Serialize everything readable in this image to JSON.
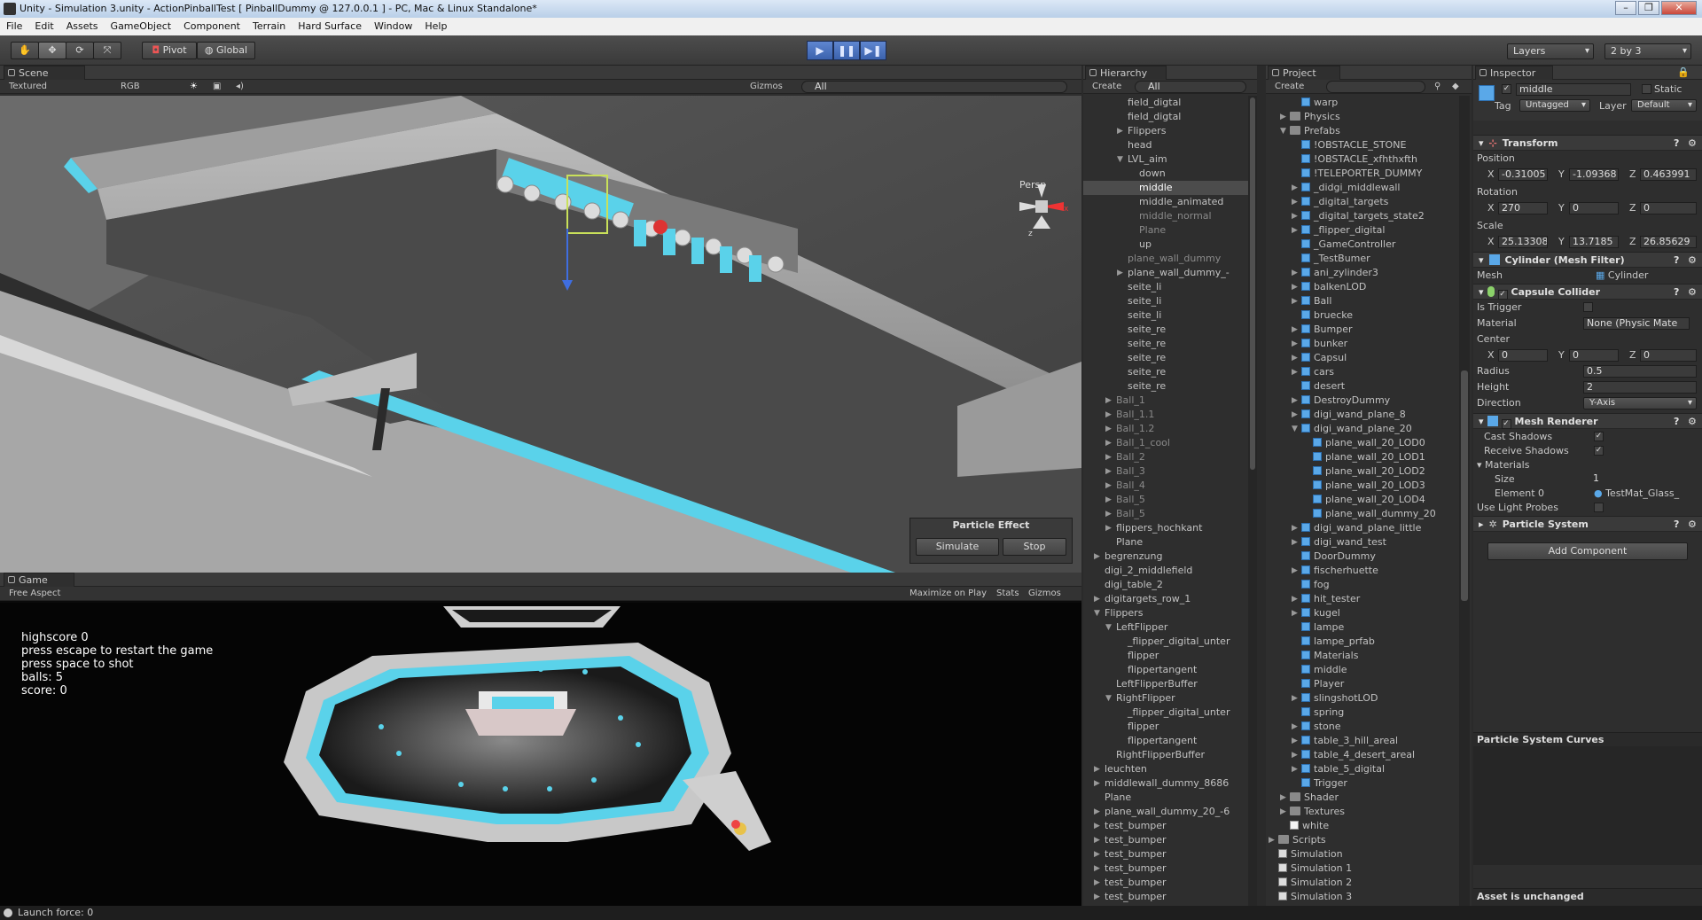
{
  "window": {
    "title": "Unity - Simulation 3.unity - ActionPinballTest [ PinballDummy @ 127.0.0.1 ] - PC, Mac & Linux Standalone*"
  },
  "menu": [
    "File",
    "Edit",
    "Assets",
    "GameObject",
    "Component",
    "Terrain",
    "Hard Surface",
    "Window",
    "Help"
  ],
  "toolbar": {
    "pivot": "Pivot",
    "global": "Global",
    "layers": "Layers",
    "layout": "2 by 3"
  },
  "scene": {
    "tab": "Scene",
    "shading": "Textured",
    "render_mode": "RGB",
    "gizmos": "Gizmos",
    "search": "All",
    "persp": "Persp",
    "particle_title": "Particle Effect",
    "simulate": "Simulate",
    "stop": "Stop"
  },
  "game": {
    "tab": "Game",
    "aspect": "Free Aspect",
    "maximize": "Maximize on Play",
    "stats": "Stats",
    "gizmos": "Gizmos",
    "lines": [
      "highscore 0",
      "press escape to restart the game",
      "press space to shot",
      "balls: 5",
      "score: 0"
    ]
  },
  "hierarchy": {
    "tab": "Hierarchy",
    "create": "Create",
    "search": "All",
    "items": [
      {
        "t": "field_digtal",
        "d": 2
      },
      {
        "t": "field_digtal",
        "d": 2
      },
      {
        "t": "Flippers",
        "d": 2,
        "a": "r"
      },
      {
        "t": "head",
        "d": 2
      },
      {
        "t": "LVL_aim",
        "d": 2,
        "a": "d"
      },
      {
        "t": "down",
        "d": 3
      },
      {
        "t": "middle",
        "d": 3,
        "sel": true
      },
      {
        "t": "middle_animated",
        "d": 3
      },
      {
        "t": "middle_normal",
        "d": 3,
        "dim": true
      },
      {
        "t": "Plane",
        "d": 3,
        "dim": true
      },
      {
        "t": "up",
        "d": 3
      },
      {
        "t": "plane_wall_dummy",
        "d": 2,
        "dim": true
      },
      {
        "t": "plane_wall_dummy_-",
        "d": 2,
        "a": "r"
      },
      {
        "t": "seite_li",
        "d": 2
      },
      {
        "t": "seite_li",
        "d": 2
      },
      {
        "t": "seite_li",
        "d": 2
      },
      {
        "t": "seite_re",
        "d": 2
      },
      {
        "t": "seite_re",
        "d": 2
      },
      {
        "t": "seite_re",
        "d": 2
      },
      {
        "t": "seite_re",
        "d": 2
      },
      {
        "t": "seite_re",
        "d": 2
      },
      {
        "t": "Ball_1",
        "d": 1,
        "a": "r",
        "dim": true
      },
      {
        "t": "Ball_1.1",
        "d": 1,
        "a": "r",
        "dim": true
      },
      {
        "t": "Ball_1.2",
        "d": 1,
        "a": "r",
        "dim": true
      },
      {
        "t": "Ball_1_cool",
        "d": 1,
        "a": "r",
        "dim": true
      },
      {
        "t": "Ball_2",
        "d": 1,
        "a": "r",
        "dim": true
      },
      {
        "t": "Ball_3",
        "d": 1,
        "a": "r",
        "dim": true
      },
      {
        "t": "Ball_4",
        "d": 1,
        "a": "r",
        "dim": true
      },
      {
        "t": "Ball_5",
        "d": 1,
        "a": "r",
        "dim": true
      },
      {
        "t": "Ball_5",
        "d": 1,
        "a": "r",
        "dim": true
      },
      {
        "t": "flippers_hochkant",
        "d": 1,
        "a": "r"
      },
      {
        "t": "Plane",
        "d": 1
      },
      {
        "t": "begrenzung",
        "d": 0,
        "a": "r"
      },
      {
        "t": "digi_2_middlefield",
        "d": 0
      },
      {
        "t": "digi_table_2",
        "d": 0
      },
      {
        "t": "digitargets_row_1",
        "d": 0,
        "a": "r"
      },
      {
        "t": "Flippers",
        "d": 0,
        "a": "d"
      },
      {
        "t": "LeftFlipper",
        "d": 1,
        "a": "d"
      },
      {
        "t": "_flipper_digital_unter",
        "d": 2
      },
      {
        "t": "flipper",
        "d": 2
      },
      {
        "t": "flippertangent",
        "d": 2
      },
      {
        "t": "LeftFlipperBuffer",
        "d": 1
      },
      {
        "t": "RightFlipper",
        "d": 1,
        "a": "d"
      },
      {
        "t": "_flipper_digital_unter",
        "d": 2
      },
      {
        "t": "flipper",
        "d": 2
      },
      {
        "t": "flippertangent",
        "d": 2
      },
      {
        "t": "RightFlipperBuffer",
        "d": 1
      },
      {
        "t": "leuchten",
        "d": 0,
        "a": "r"
      },
      {
        "t": "middlewall_dummy_8686",
        "d": 0,
        "a": "r"
      },
      {
        "t": "Plane",
        "d": 0
      },
      {
        "t": "plane_wall_dummy_20_-6",
        "d": 0,
        "a": "r"
      },
      {
        "t": "test_bumper",
        "d": 0,
        "a": "r"
      },
      {
        "t": "test_bumper",
        "d": 0,
        "a": "r"
      },
      {
        "t": "test_bumper",
        "d": 0,
        "a": "r"
      },
      {
        "t": "test_bumper",
        "d": 0,
        "a": "r"
      },
      {
        "t": "test_bumper",
        "d": 0,
        "a": "r"
      },
      {
        "t": "test_bumper",
        "d": 0,
        "a": "r"
      }
    ]
  },
  "project": {
    "tab": "Project",
    "create": "Create",
    "items": [
      {
        "t": "warp",
        "d": 2,
        "k": "c"
      },
      {
        "t": "Physics",
        "d": 1,
        "k": "f",
        "a": "r"
      },
      {
        "t": "Prefabs",
        "d": 1,
        "k": "f",
        "a": "d"
      },
      {
        "t": "!OBSTACLE_STONE",
        "d": 2,
        "k": "c"
      },
      {
        "t": "!OBSTACLE_xfhthxfth",
        "d": 2,
        "k": "c"
      },
      {
        "t": "!TELEPORTER_DUMMY",
        "d": 2,
        "k": "c"
      },
      {
        "t": "_didgi_middlewall",
        "d": 2,
        "k": "c",
        "a": "r"
      },
      {
        "t": "_digital_targets",
        "d": 2,
        "k": "c",
        "a": "r"
      },
      {
        "t": "_digital_targets_state2",
        "d": 2,
        "k": "c",
        "a": "r"
      },
      {
        "t": "_flipper_digital",
        "d": 2,
        "k": "c",
        "a": "r"
      },
      {
        "t": "_GameController",
        "d": 2,
        "k": "c"
      },
      {
        "t": "_TestBumer",
        "d": 2,
        "k": "c"
      },
      {
        "t": "ani_zylinder3",
        "d": 2,
        "k": "c",
        "a": "r"
      },
      {
        "t": "balkenLOD",
        "d": 2,
        "k": "c",
        "a": "r"
      },
      {
        "t": "Ball",
        "d": 2,
        "k": "c",
        "a": "r"
      },
      {
        "t": "bruecke",
        "d": 2,
        "k": "c"
      },
      {
        "t": "Bumper",
        "d": 2,
        "k": "c",
        "a": "r"
      },
      {
        "t": "bunker",
        "d": 2,
        "k": "c",
        "a": "r"
      },
      {
        "t": "Capsul",
        "d": 2,
        "k": "c",
        "a": "r"
      },
      {
        "t": "cars",
        "d": 2,
        "k": "c",
        "a": "r"
      },
      {
        "t": "desert",
        "d": 2,
        "k": "c"
      },
      {
        "t": "DestroyDummy",
        "d": 2,
        "k": "c",
        "a": "r"
      },
      {
        "t": "digi_wand_plane_8",
        "d": 2,
        "k": "c",
        "a": "r"
      },
      {
        "t": "digi_wand_plane_20",
        "d": 2,
        "k": "c",
        "a": "d"
      },
      {
        "t": "plane_wall_20_LOD0",
        "d": 3,
        "k": "c"
      },
      {
        "t": "plane_wall_20_LOD1",
        "d": 3,
        "k": "c"
      },
      {
        "t": "plane_wall_20_LOD2",
        "d": 3,
        "k": "c"
      },
      {
        "t": "plane_wall_20_LOD3",
        "d": 3,
        "k": "c"
      },
      {
        "t": "plane_wall_20_LOD4",
        "d": 3,
        "k": "c"
      },
      {
        "t": "plane_wall_dummy_20",
        "d": 3,
        "k": "c"
      },
      {
        "t": "digi_wand_plane_little",
        "d": 2,
        "k": "c",
        "a": "r"
      },
      {
        "t": "digi_wand_test",
        "d": 2,
        "k": "c",
        "a": "r"
      },
      {
        "t": "DoorDummy",
        "d": 2,
        "k": "c"
      },
      {
        "t": "fischerhuette",
        "d": 2,
        "k": "c",
        "a": "r"
      },
      {
        "t": "fog",
        "d": 2,
        "k": "c"
      },
      {
        "t": "hit_tester",
        "d": 2,
        "k": "c",
        "a": "r"
      },
      {
        "t": "kugel",
        "d": 2,
        "k": "c",
        "a": "r"
      },
      {
        "t": "lampe",
        "d": 2,
        "k": "c"
      },
      {
        "t": "lampe_prfab",
        "d": 2,
        "k": "c"
      },
      {
        "t": "Materials",
        "d": 2,
        "k": "c"
      },
      {
        "t": "middle",
        "d": 2,
        "k": "c"
      },
      {
        "t": "Player",
        "d": 2,
        "k": "c"
      },
      {
        "t": "slingshotLOD",
        "d": 2,
        "k": "c",
        "a": "r"
      },
      {
        "t": "spring",
        "d": 2,
        "k": "c"
      },
      {
        "t": "stone",
        "d": 2,
        "k": "c",
        "a": "r"
      },
      {
        "t": "table_3_hill_areal",
        "d": 2,
        "k": "c",
        "a": "r"
      },
      {
        "t": "table_4_desert_areal",
        "d": 2,
        "k": "c",
        "a": "r"
      },
      {
        "t": "table_5_digital",
        "d": 2,
        "k": "c",
        "a": "r"
      },
      {
        "t": "Trigger",
        "d": 2,
        "k": "c"
      },
      {
        "t": "Shader",
        "d": 1,
        "k": "f",
        "a": "r"
      },
      {
        "t": "Textures",
        "d": 1,
        "k": "f",
        "a": "r"
      },
      {
        "t": "white",
        "d": 1,
        "k": "w"
      },
      {
        "t": "Scripts",
        "d": 0,
        "k": "f",
        "a": "r"
      },
      {
        "t": "Simulation",
        "d": 0,
        "k": "s"
      },
      {
        "t": "Simulation 1",
        "d": 0,
        "k": "s"
      },
      {
        "t": "Simulation 2",
        "d": 0,
        "k": "s"
      },
      {
        "t": "Simulation 3",
        "d": 0,
        "k": "s"
      }
    ]
  },
  "inspector": {
    "tab": "Inspector",
    "name": "middle",
    "static": "Static",
    "tag_label": "Tag",
    "tag": "Untagged",
    "layer_label": "Layer",
    "layer": "Default",
    "transform": {
      "title": "Transform",
      "position": "Position",
      "rotation": "Rotation",
      "scale": "Scale",
      "pos": [
        "-0.31005",
        "-1.09368",
        "0.463991"
      ],
      "rot": [
        "270",
        "0",
        "0"
      ],
      "scl": [
        "25.13308",
        "13.7185",
        "26.85629"
      ]
    },
    "mesh_filter": {
      "title": "Cylinder (Mesh Filter)",
      "mesh_label": "Mesh",
      "mesh": "Cylinder"
    },
    "capsule": {
      "title": "Capsule Collider",
      "is_trigger": "Is Trigger",
      "material_label": "Material",
      "material": "None (Physic Mate",
      "center": "Center",
      "center_v": [
        "0",
        "0",
        "0"
      ],
      "radius_label": "Radius",
      "radius": "0.5",
      "height_label": "Height",
      "height": "2",
      "direction_label": "Direction",
      "direction": "Y-Axis"
    },
    "renderer": {
      "title": "Mesh Renderer",
      "cast": "Cast Shadows",
      "receive": "Receive Shadows",
      "materials": "Materials",
      "size_label": "Size",
      "size": "1",
      "element_label": "Element 0",
      "element": "TestMat_Glass_",
      "probes": "Use Light Probes"
    },
    "particle": {
      "title": "Particle System"
    },
    "add_component": "Add Component",
    "curves": "Particle System Curves",
    "asset_status": "Asset is unchanged"
  },
  "status": {
    "text": "Launch force: 0"
  },
  "colors": {
    "accent": "#3f87d6",
    "cyan": "#5ad2ea",
    "panel": "#2e2e2e"
  }
}
